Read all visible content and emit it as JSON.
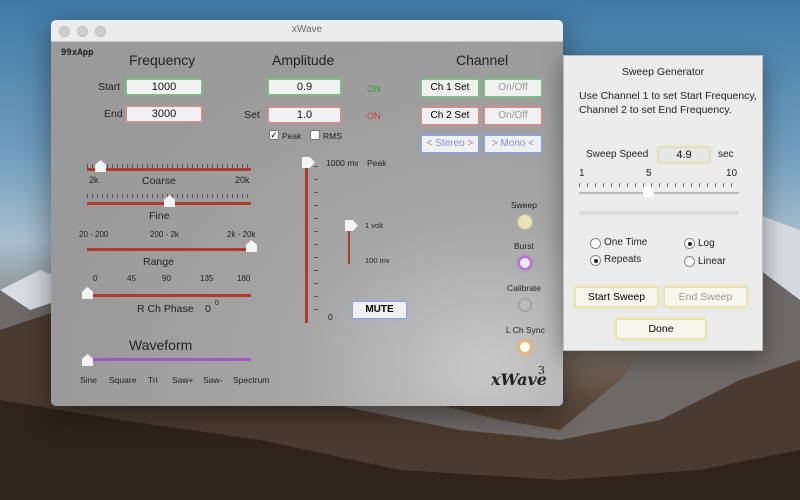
{
  "main_window": {
    "title": "xWave",
    "brand": "99xApp",
    "logo": "xWave",
    "logo_sup": "3",
    "frequency": {
      "heading": "Frequency",
      "start_label": "Start",
      "start_value": "1000",
      "end_label": "End",
      "end_value": "3000",
      "coarse_label": "Coarse",
      "coarse_min": "2k",
      "coarse_max": "20k",
      "coarse_level": 0.08,
      "fine_label": "Fine",
      "fine_level": 0.5,
      "range_label": "Range",
      "range_options": [
        "20 - 200",
        "200 - 2k",
        "2k - 20k"
      ],
      "range_level": 1.0,
      "phase_ticks": [
        "0",
        "45",
        "90",
        "135",
        "180"
      ],
      "phase_label": "R Ch Phase",
      "phase_value": "0",
      "phase_unit": "0",
      "phase_level": 0.0
    },
    "amplitude": {
      "heading": "Amplitude",
      "value1": "0.9",
      "value1_status": "ON",
      "set_label": "Set",
      "value2": "1.0",
      "value2_status": "ON",
      "peak_label": "Peak",
      "peak_checked": true,
      "rms_label": "RMS",
      "rms_checked": false,
      "scale_top": "1000 mv",
      "scale_top_mode": "Peak",
      "scale_mid": "1 volt",
      "scale_low": "100 mv",
      "scale_zero": "0",
      "mute_label": "MUTE"
    },
    "channel": {
      "heading": "Channel",
      "ch1_label": "Ch 1 Set",
      "ch1_onoff": "On/Off",
      "ch2_label": "Ch 2 Set",
      "ch2_onoff": "On/Off",
      "stereo_label": "< Stereo >",
      "mono_label": "> Mono <"
    },
    "indicators": {
      "sweep": "Sweep",
      "burst": "Burst",
      "calibrate": "Calibrate",
      "lch_sync": "L Ch Sync"
    },
    "waveform": {
      "heading": "Waveform",
      "options": [
        "Sine",
        "Square",
        "Tri",
        "Saw+",
        "Saw-",
        "Spectrum"
      ],
      "level": 0.0
    }
  },
  "sweep_window": {
    "title": "Sweep Generator",
    "description": "Use Channel 1 to set Start Frequency, Channel 2 to set End Frequency.",
    "speed_label": "Sweep Speed",
    "speed_value": "4.9",
    "speed_unit": "sec",
    "scale": [
      "1",
      "5",
      "10"
    ],
    "speed_level": 0.43,
    "one_time": "One Time",
    "repeats": "Repeats",
    "log": "Log",
    "linear": "Linear",
    "start_sweep": "Start Sweep",
    "end_sweep": "End Sweep",
    "done": "Done"
  },
  "colors": {
    "slider_track": "#b03a2e",
    "waveform_track": "#a05bb8",
    "on_green": "#3b9a3b",
    "on_red": "#cc3b3b"
  }
}
